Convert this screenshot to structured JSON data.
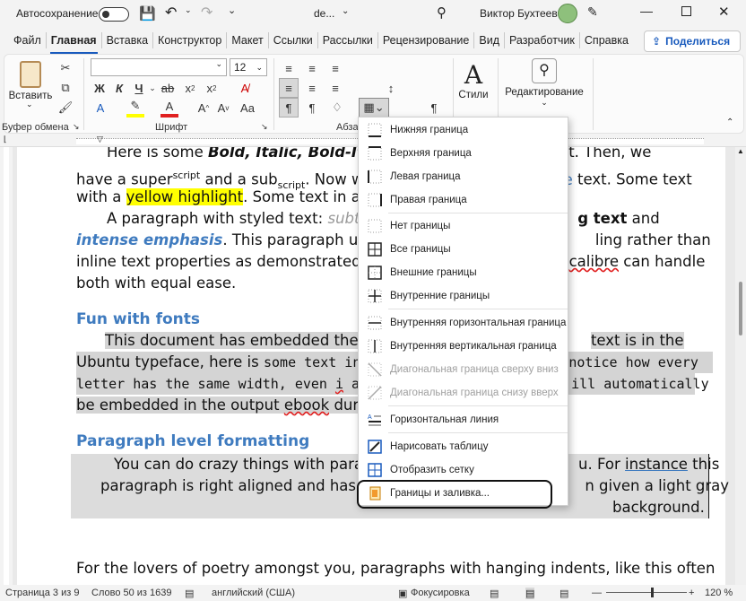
{
  "titlebar": {
    "autosave": "Автосохранение",
    "doc_name": "de...",
    "user": "Виктор Бухтеев"
  },
  "tabs": [
    "Файл",
    "Главная",
    "Вставка",
    "Конструктор",
    "Макет",
    "Ссылки",
    "Рассылки",
    "Рецензирование",
    "Вид",
    "Разработчик",
    "Справка"
  ],
  "share": "Поделиться",
  "ribbon": {
    "paste": "Вставить",
    "font_size": "12",
    "font_name": "",
    "styles": "Стили",
    "editing": "Редактирование",
    "groups": [
      "Буфер обмена",
      "Шрифт",
      "Абза"
    ]
  },
  "colors": {
    "accent": "#185abd",
    "highlight": "#ffff00",
    "font_red": "#e02020",
    "heading": "#3f7bbf",
    "selection_gray": "#d4d4d4"
  },
  "doc": {
    "l1a": "Here is some ",
    "l1b": "Bold, Italic, Bold-Italic",
    "l1c": "text. Then, we",
    "l2a": "have a super",
    "l2b": "script",
    "l2c": " and a sub",
    "l2d": "script",
    "l2e": ". Now we",
    "l2f": "e",
    "l2g": " text. Some text",
    "l3a": "with a ",
    "l3b": "yellow highlight",
    "l3c": ". Some text in a ",
    "l3d": "o",
    "l4a": "A paragraph with styled text: ",
    "l4b": "subtle",
    "l4c": "g text",
    "l4d": " and",
    "l5a": "intense emphasis",
    "l5b": ". This paragraph uses ",
    "l5c": "ling rather than",
    "l6a": "inline text properties as demonstrated",
    "l6b": "calibre",
    "l6c": " can handle",
    "l7": "both with equal ease.",
    "h1": "Fun with fonts",
    "f1a": "This document has embedded the U",
    "f1b": "text is in the",
    "f2a": "Ubuntu typeface, here is ",
    "f2b": "some text in",
    "f2c": "notice how every",
    "f3a": "letter has the same width, even ",
    "f3b": "i",
    "f3c": " a",
    "f3d": "ill automatically",
    "f4a": "be embedded in the output ",
    "f4b": "ebook",
    "f4c": " duri",
    "h2": "Paragraph level formatting",
    "r1a": "You can do crazy things with para",
    "r1b": "u. For ",
    "r1c": "instance",
    "r1d": " this",
    "r2a": "paragraph is right aligned and has a",
    "r2b": "n given a light gray",
    "r3": "background.",
    "last": "For the lovers of poetry amongst you, paragraphs with hanging indents, like this often"
  },
  "menu": [
    {
      "label": "Нижняя граница",
      "icon": "border-bottom-icon",
      "disabled": false
    },
    {
      "label": "Верхняя граница",
      "icon": "border-top-icon",
      "disabled": false
    },
    {
      "label": "Левая граница",
      "icon": "border-left-icon",
      "disabled": false
    },
    {
      "label": "Правая граница",
      "icon": "border-right-icon",
      "disabled": false
    },
    {
      "label": "Нет границы",
      "icon": "border-none-icon",
      "disabled": false
    },
    {
      "label": "Все границы",
      "icon": "border-all-icon",
      "disabled": false
    },
    {
      "label": "Внешние границы",
      "icon": "border-outside-icon",
      "disabled": false
    },
    {
      "label": "Внутренние границы",
      "icon": "border-inside-icon",
      "disabled": false
    },
    {
      "label": "Внутренняя горизонтальная граница",
      "icon": "border-inside-horizontal-icon",
      "disabled": false
    },
    {
      "label": "Внутренняя вертикальная граница",
      "icon": "border-inside-vertical-icon",
      "disabled": false
    },
    {
      "label": "Диагональная граница сверху вниз",
      "icon": "diagonal-down-icon",
      "disabled": true
    },
    {
      "label": "Диагональная граница снизу вверх",
      "icon": "diagonal-up-icon",
      "disabled": true
    },
    {
      "label": "Горизонтальная линия",
      "icon": "horizontal-line-icon",
      "disabled": false
    },
    {
      "label": "Нарисовать таблицу",
      "icon": "draw-table-icon",
      "disabled": false
    },
    {
      "label": "Отобразить сетку",
      "icon": "view-gridlines-icon",
      "disabled": false
    },
    {
      "label": "Границы и заливка...",
      "icon": "borders-shading-icon",
      "disabled": false
    }
  ],
  "status": {
    "page": "Страница 3 из 9",
    "words": "Слово 50 из 1639",
    "lang": "английский (США)",
    "focus": "Фокусировка",
    "zoom": "120 %"
  }
}
